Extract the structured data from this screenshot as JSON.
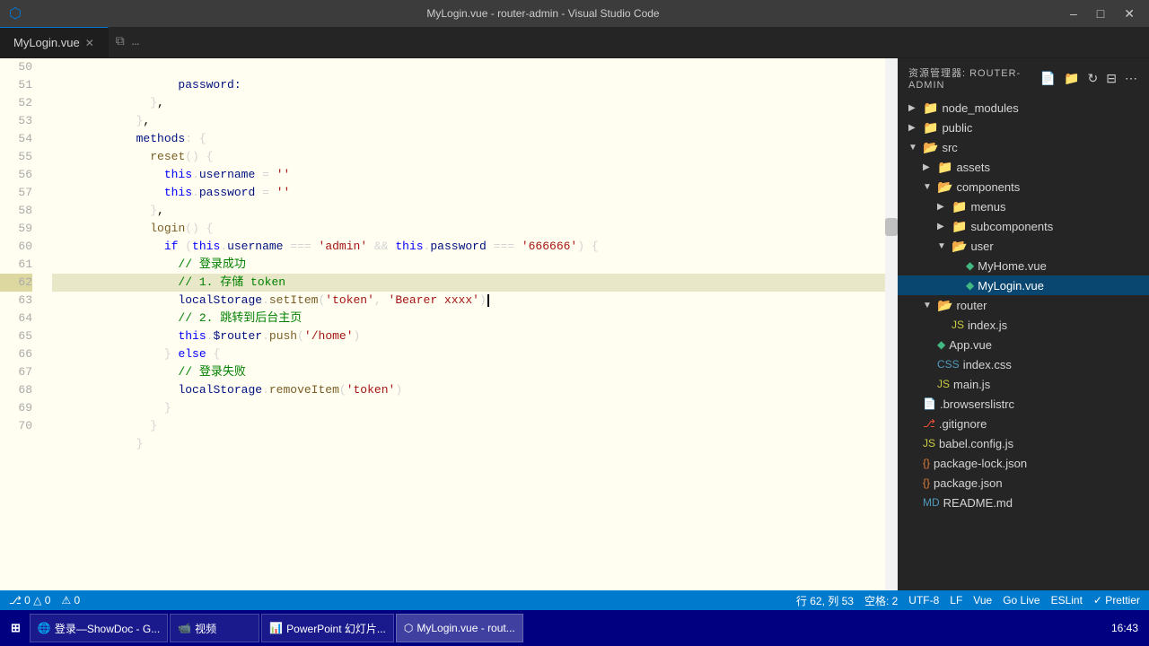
{
  "titleBar": {
    "title": "MyLogin.vue - router-admin - Visual Studio Code",
    "icon": "⬛"
  },
  "tabs": [
    {
      "label": "MyLogin.vue",
      "active": true,
      "modified": false
    }
  ],
  "editor": {
    "backgroundColor": "#fffef0",
    "lines": [
      {
        "num": 50,
        "content": "        password:"
      },
      {
        "num": 51,
        "content": "    },"
      },
      {
        "num": 52,
        "content": "  },"
      },
      {
        "num": 53,
        "content": "  methods: {"
      },
      {
        "num": 54,
        "content": "    reset() {"
      },
      {
        "num": 55,
        "content": "      this.username = ''"
      },
      {
        "num": 56,
        "content": "      this.password = ''"
      },
      {
        "num": 57,
        "content": "    },"
      },
      {
        "num": 58,
        "content": "    login() {"
      },
      {
        "num": 59,
        "content": "      if (this.username === 'admin' && this.password === '666666') {"
      },
      {
        "num": 60,
        "content": "        // 登录成功"
      },
      {
        "num": 61,
        "content": "        // 1. 存储 token"
      },
      {
        "num": 62,
        "content": "        localStorage.setItem('token', 'Bearer xxxx')",
        "current": true
      },
      {
        "num": 63,
        "content": "        // 2. 跳转到后台主页"
      },
      {
        "num": 64,
        "content": "        this.$router.push('/home')"
      },
      {
        "num": 65,
        "content": "      } else {"
      },
      {
        "num": 66,
        "content": "        // 登录失败"
      },
      {
        "num": 67,
        "content": "        localStorage.removeItem('token')"
      },
      {
        "num": 68,
        "content": "      }"
      },
      {
        "num": 69,
        "content": "    }"
      },
      {
        "num": 70,
        "content": "  }"
      }
    ]
  },
  "sidebar": {
    "header": "资源管理器: ROUTER-ADMIN",
    "tree": [
      {
        "label": "node_modules",
        "type": "folder",
        "indent": 1,
        "expanded": false
      },
      {
        "label": "public",
        "type": "folder",
        "indent": 1,
        "expanded": false
      },
      {
        "label": "src",
        "type": "folder-open",
        "indent": 1,
        "expanded": true
      },
      {
        "label": "assets",
        "type": "folder",
        "indent": 2,
        "expanded": false
      },
      {
        "label": "components",
        "type": "folder-open",
        "indent": 2,
        "expanded": true
      },
      {
        "label": "menus",
        "type": "folder",
        "indent": 3,
        "expanded": false
      },
      {
        "label": "subcomponents",
        "type": "folder",
        "indent": 3,
        "expanded": false
      },
      {
        "label": "user",
        "type": "folder-open",
        "indent": 3,
        "expanded": true
      },
      {
        "label": "MyHome.vue",
        "type": "vue",
        "indent": 4
      },
      {
        "label": "MyLogin.vue",
        "type": "vue",
        "indent": 4,
        "selected": true
      },
      {
        "label": "router",
        "type": "folder-open",
        "indent": 2,
        "expanded": true
      },
      {
        "label": "index.js",
        "type": "js",
        "indent": 3
      },
      {
        "label": "App.vue",
        "type": "vue",
        "indent": 2
      },
      {
        "label": "index.css",
        "type": "css",
        "indent": 2
      },
      {
        "label": "main.js",
        "type": "js",
        "indent": 2
      },
      {
        "label": ".browserslistrc",
        "type": "file",
        "indent": 1
      },
      {
        "label": ".gitignore",
        "type": "git",
        "indent": 1
      },
      {
        "label": "babel.config.js",
        "type": "js",
        "indent": 1
      },
      {
        "label": "package-lock.json",
        "type": "json",
        "indent": 1
      },
      {
        "label": "package.json",
        "type": "json",
        "indent": 1
      },
      {
        "label": "README.md",
        "type": "md",
        "indent": 1
      }
    ]
  },
  "statusBar": {
    "left": [
      {
        "text": "⎇ 0 △ 0",
        "name": "git-status"
      },
      {
        "text": "⚠ 0",
        "name": "errors"
      }
    ],
    "right": [
      {
        "text": "行 62, 列 53",
        "name": "cursor-position"
      },
      {
        "text": "空格: 2",
        "name": "indent"
      },
      {
        "text": "UTF-8",
        "name": "encoding"
      },
      {
        "text": "LF",
        "name": "line-ending"
      },
      {
        "text": "Vue",
        "name": "language"
      },
      {
        "text": "Go Live",
        "name": "go-live"
      },
      {
        "text": "ESLint",
        "name": "eslint"
      },
      {
        "text": "✓ Prettier",
        "name": "prettier"
      }
    ]
  },
  "taskbar": {
    "time": "16:43",
    "buttons": [
      {
        "label": "登录—ShowDoc - G...",
        "icon": "🌐"
      },
      {
        "label": "视频",
        "icon": "📹"
      },
      {
        "label": "PowerPoint 幻灯片...",
        "icon": "📊"
      },
      {
        "label": "MyLogin.vue - rout...",
        "icon": "⬛",
        "active": true
      }
    ]
  }
}
